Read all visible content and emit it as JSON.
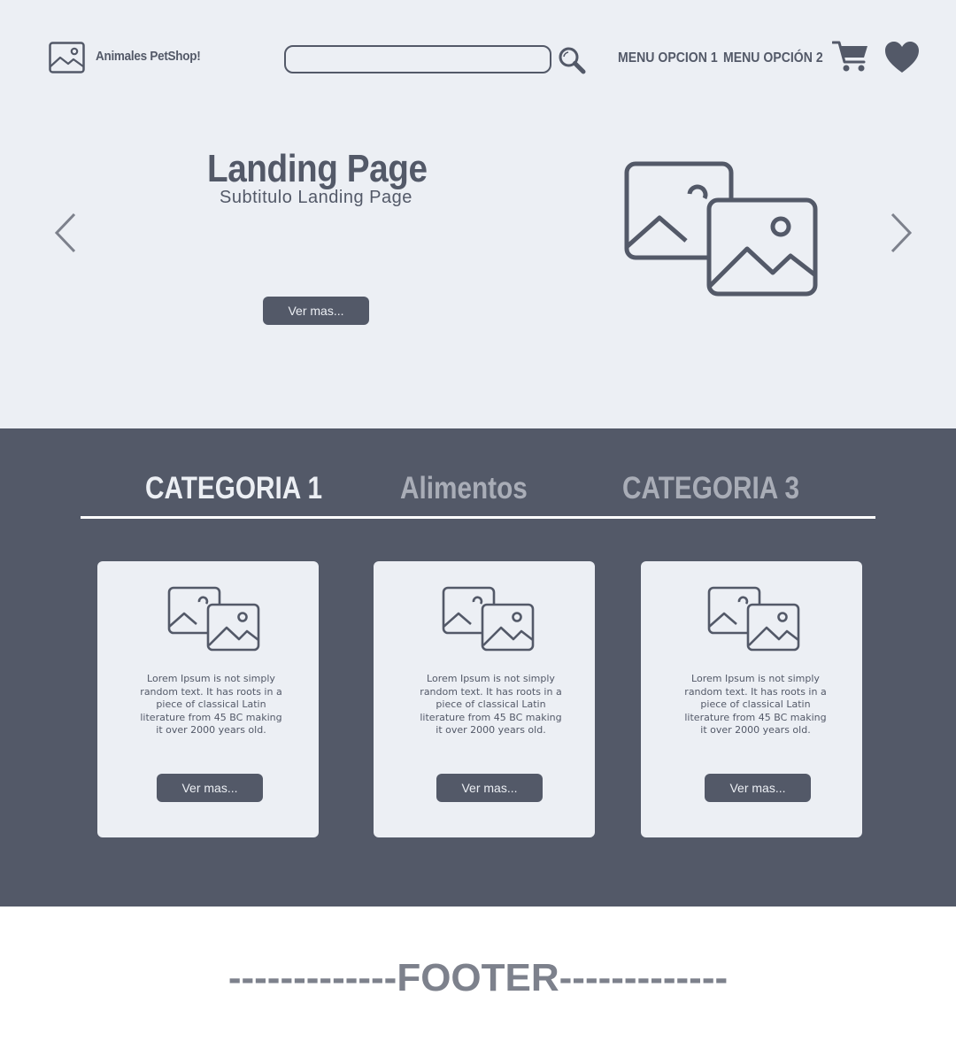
{
  "header": {
    "brand": "Animales PetShop!",
    "logo_icon": "image-icon",
    "search": {
      "value": "",
      "placeholder": ""
    },
    "search_icon": "magnifier-icon",
    "menu": [
      {
        "label": "MENU OPCION 1"
      },
      {
        "label": "MENU OPCIÓN 2"
      }
    ],
    "cart_icon": "cart-icon",
    "favorites_icon": "heart-icon"
  },
  "hero": {
    "title": "Landing Page",
    "subtitle": "Subtitulo Landing Page",
    "button_label": "Ver mas...",
    "image_icon": "images-icon",
    "prev_icon": "chevron-left-icon",
    "next_icon": "chevron-right-icon"
  },
  "categories": {
    "tabs": [
      {
        "label": "CATEGORIA 1",
        "active": true
      },
      {
        "label": "Alimentos",
        "active": false
      },
      {
        "label": "CATEGORIA 3",
        "active": false
      }
    ],
    "cards": [
      {
        "text": "Lorem Ipsum is not simply random text. It has roots in a piece of classical Latin literature from 45 BC making it over 2000 years old.",
        "button_label": "Ver mas..."
      },
      {
        "text": "Lorem Ipsum is not simply random text. It has roots in a piece of classical Latin literature from 45 BC making it over 2000 years old.",
        "button_label": "Ver mas..."
      },
      {
        "text": "Lorem Ipsum is not simply random text. It has roots in a piece of classical Latin literature from 45 BC making it over 2000 years old.",
        "button_label": "Ver mas..."
      }
    ]
  },
  "footer": {
    "text": "-------------FOOTER-------------"
  },
  "colors": {
    "primary": "#535968",
    "background_light": "#eceff4",
    "inactive_tab": "#a9adb7",
    "footer_text": "#7d818c"
  }
}
